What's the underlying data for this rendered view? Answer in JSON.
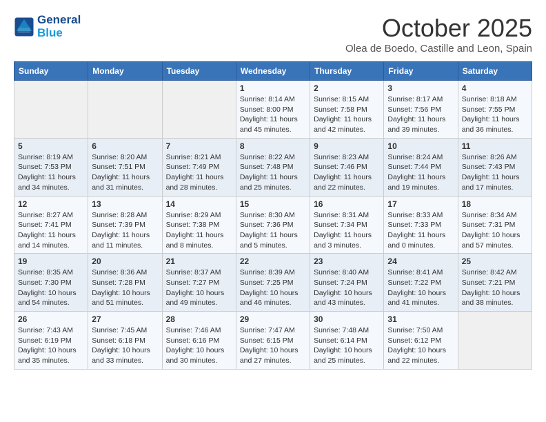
{
  "header": {
    "logo_line1": "General",
    "logo_line2": "Blue",
    "month": "October 2025",
    "location": "Olea de Boedo, Castille and Leon, Spain"
  },
  "weekdays": [
    "Sunday",
    "Monday",
    "Tuesday",
    "Wednesday",
    "Thursday",
    "Friday",
    "Saturday"
  ],
  "weeks": [
    [
      {
        "day": "",
        "info": ""
      },
      {
        "day": "",
        "info": ""
      },
      {
        "day": "",
        "info": ""
      },
      {
        "day": "1",
        "info": "Sunrise: 8:14 AM\nSunset: 8:00 PM\nDaylight: 11 hours and 45 minutes."
      },
      {
        "day": "2",
        "info": "Sunrise: 8:15 AM\nSunset: 7:58 PM\nDaylight: 11 hours and 42 minutes."
      },
      {
        "day": "3",
        "info": "Sunrise: 8:17 AM\nSunset: 7:56 PM\nDaylight: 11 hours and 39 minutes."
      },
      {
        "day": "4",
        "info": "Sunrise: 8:18 AM\nSunset: 7:55 PM\nDaylight: 11 hours and 36 minutes."
      }
    ],
    [
      {
        "day": "5",
        "info": "Sunrise: 8:19 AM\nSunset: 7:53 PM\nDaylight: 11 hours and 34 minutes."
      },
      {
        "day": "6",
        "info": "Sunrise: 8:20 AM\nSunset: 7:51 PM\nDaylight: 11 hours and 31 minutes."
      },
      {
        "day": "7",
        "info": "Sunrise: 8:21 AM\nSunset: 7:49 PM\nDaylight: 11 hours and 28 minutes."
      },
      {
        "day": "8",
        "info": "Sunrise: 8:22 AM\nSunset: 7:48 PM\nDaylight: 11 hours and 25 minutes."
      },
      {
        "day": "9",
        "info": "Sunrise: 8:23 AM\nSunset: 7:46 PM\nDaylight: 11 hours and 22 minutes."
      },
      {
        "day": "10",
        "info": "Sunrise: 8:24 AM\nSunset: 7:44 PM\nDaylight: 11 hours and 19 minutes."
      },
      {
        "day": "11",
        "info": "Sunrise: 8:26 AM\nSunset: 7:43 PM\nDaylight: 11 hours and 17 minutes."
      }
    ],
    [
      {
        "day": "12",
        "info": "Sunrise: 8:27 AM\nSunset: 7:41 PM\nDaylight: 11 hours and 14 minutes."
      },
      {
        "day": "13",
        "info": "Sunrise: 8:28 AM\nSunset: 7:39 PM\nDaylight: 11 hours and 11 minutes."
      },
      {
        "day": "14",
        "info": "Sunrise: 8:29 AM\nSunset: 7:38 PM\nDaylight: 11 hours and 8 minutes."
      },
      {
        "day": "15",
        "info": "Sunrise: 8:30 AM\nSunset: 7:36 PM\nDaylight: 11 hours and 5 minutes."
      },
      {
        "day": "16",
        "info": "Sunrise: 8:31 AM\nSunset: 7:34 PM\nDaylight: 11 hours and 3 minutes."
      },
      {
        "day": "17",
        "info": "Sunrise: 8:33 AM\nSunset: 7:33 PM\nDaylight: 11 hours and 0 minutes."
      },
      {
        "day": "18",
        "info": "Sunrise: 8:34 AM\nSunset: 7:31 PM\nDaylight: 10 hours and 57 minutes."
      }
    ],
    [
      {
        "day": "19",
        "info": "Sunrise: 8:35 AM\nSunset: 7:30 PM\nDaylight: 10 hours and 54 minutes."
      },
      {
        "day": "20",
        "info": "Sunrise: 8:36 AM\nSunset: 7:28 PM\nDaylight: 10 hours and 51 minutes."
      },
      {
        "day": "21",
        "info": "Sunrise: 8:37 AM\nSunset: 7:27 PM\nDaylight: 10 hours and 49 minutes."
      },
      {
        "day": "22",
        "info": "Sunrise: 8:39 AM\nSunset: 7:25 PM\nDaylight: 10 hours and 46 minutes."
      },
      {
        "day": "23",
        "info": "Sunrise: 8:40 AM\nSunset: 7:24 PM\nDaylight: 10 hours and 43 minutes."
      },
      {
        "day": "24",
        "info": "Sunrise: 8:41 AM\nSunset: 7:22 PM\nDaylight: 10 hours and 41 minutes."
      },
      {
        "day": "25",
        "info": "Sunrise: 8:42 AM\nSunset: 7:21 PM\nDaylight: 10 hours and 38 minutes."
      }
    ],
    [
      {
        "day": "26",
        "info": "Sunrise: 7:43 AM\nSunset: 6:19 PM\nDaylight: 10 hours and 35 minutes."
      },
      {
        "day": "27",
        "info": "Sunrise: 7:45 AM\nSunset: 6:18 PM\nDaylight: 10 hours and 33 minutes."
      },
      {
        "day": "28",
        "info": "Sunrise: 7:46 AM\nSunset: 6:16 PM\nDaylight: 10 hours and 30 minutes."
      },
      {
        "day": "29",
        "info": "Sunrise: 7:47 AM\nSunset: 6:15 PM\nDaylight: 10 hours and 27 minutes."
      },
      {
        "day": "30",
        "info": "Sunrise: 7:48 AM\nSunset: 6:14 PM\nDaylight: 10 hours and 25 minutes."
      },
      {
        "day": "31",
        "info": "Sunrise: 7:50 AM\nSunset: 6:12 PM\nDaylight: 10 hours and 22 minutes."
      },
      {
        "day": "",
        "info": ""
      }
    ]
  ]
}
